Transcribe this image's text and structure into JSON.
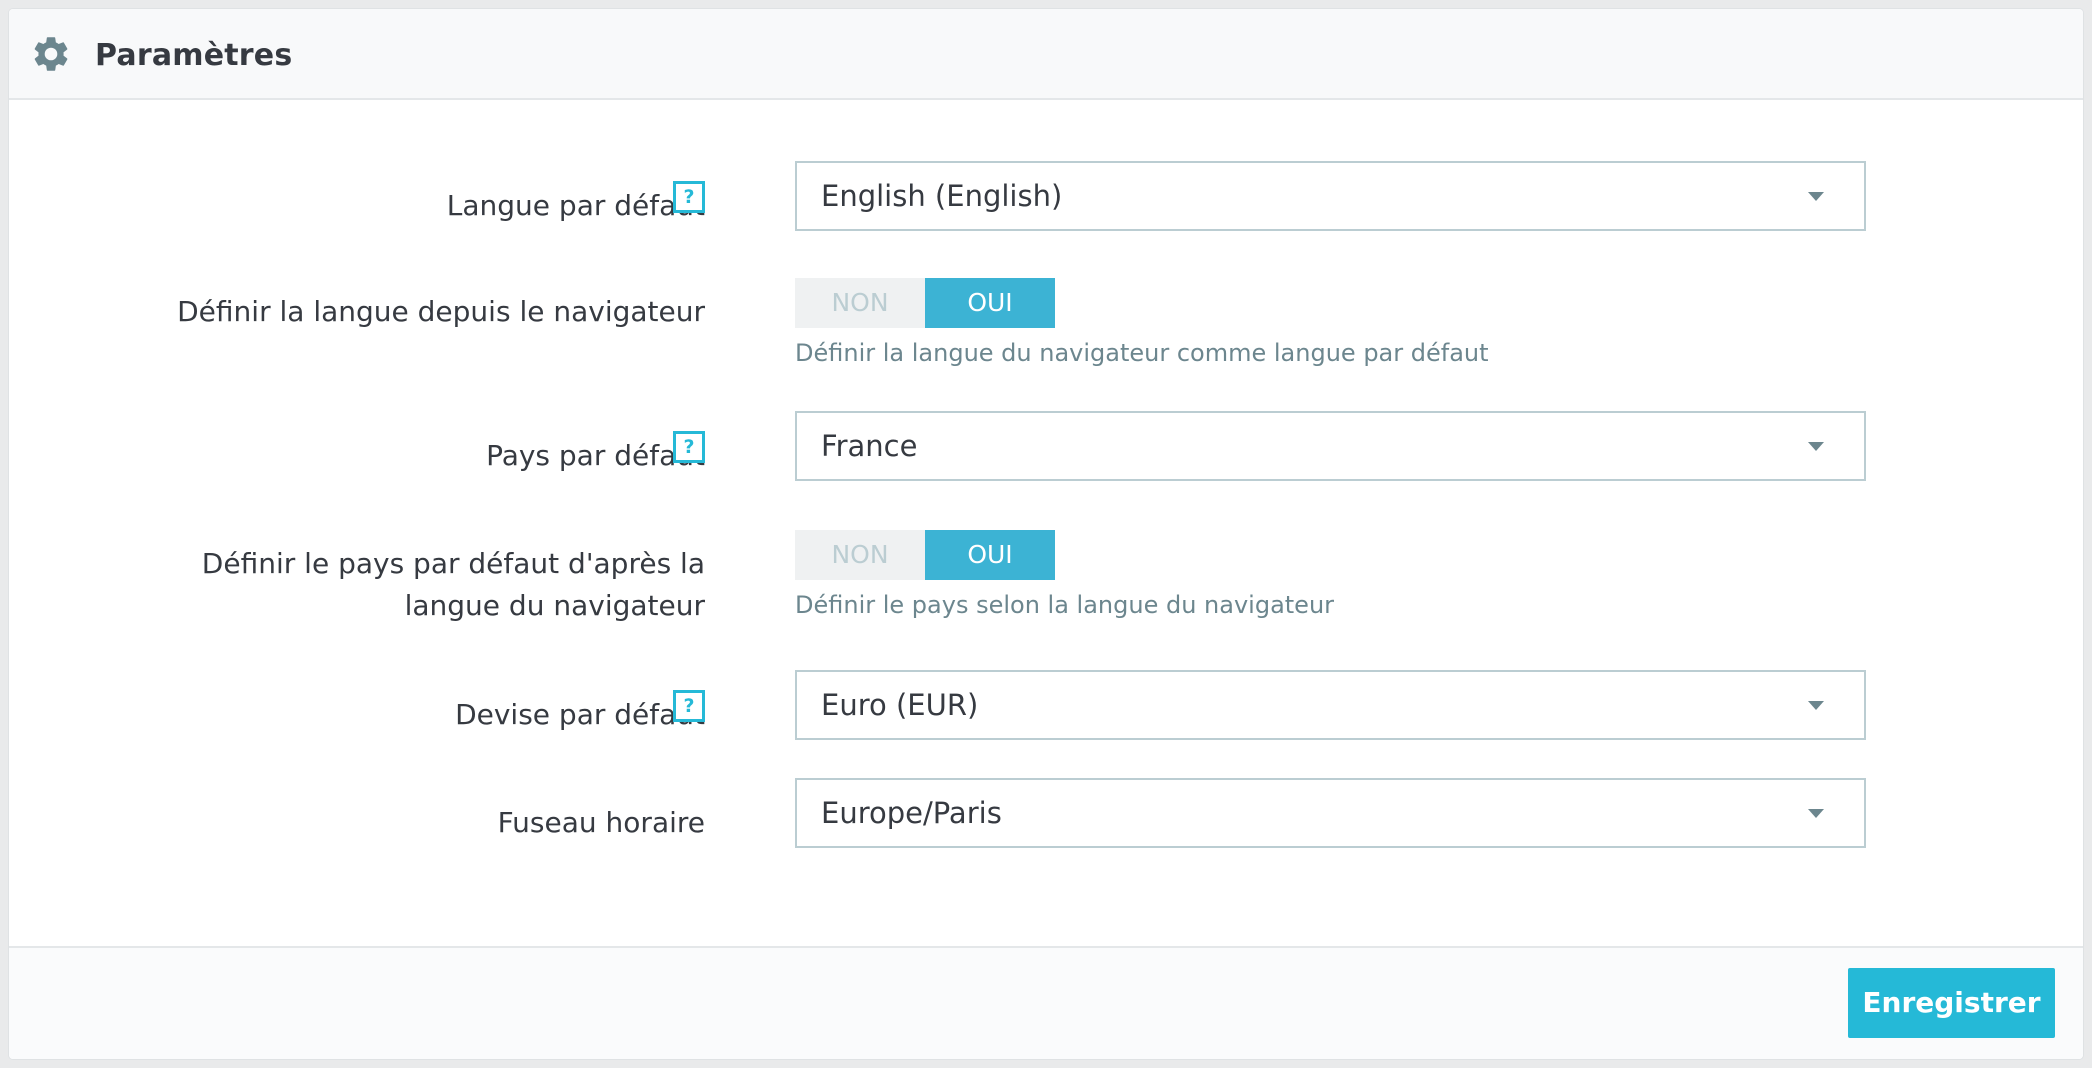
{
  "panel": {
    "title": "Paramètres",
    "icon": "gear-icon"
  },
  "fields": {
    "default_language": {
      "label": "Langue par défaut",
      "help": "?",
      "value": "English (English)"
    },
    "browser_language": {
      "label": "Définir la langue depuis le navigateur",
      "off_label": "NON",
      "on_label": "OUI",
      "selected": "OUI",
      "hint": "Définir la langue du navigateur comme langue par défaut"
    },
    "default_country": {
      "label": "Pays par défaut",
      "help": "?",
      "value": "France"
    },
    "browser_country": {
      "label_line1": "Définir le pays par défaut d'après la",
      "label_line2": "langue du navigateur",
      "off_label": "NON",
      "on_label": "OUI",
      "selected": "OUI",
      "hint": "Définir le pays selon la langue du navigateur"
    },
    "default_currency": {
      "label": "Devise par défaut",
      "help": "?",
      "value": "Euro (EUR)"
    },
    "timezone": {
      "label": "Fuseau horaire",
      "value": "Europe/Paris"
    }
  },
  "footer": {
    "save_label": "Enregistrer"
  },
  "colors": {
    "accent": "#25b9d7",
    "switch_on": "#3cb3d4",
    "text": "#363a41",
    "hint": "#6c868e"
  }
}
